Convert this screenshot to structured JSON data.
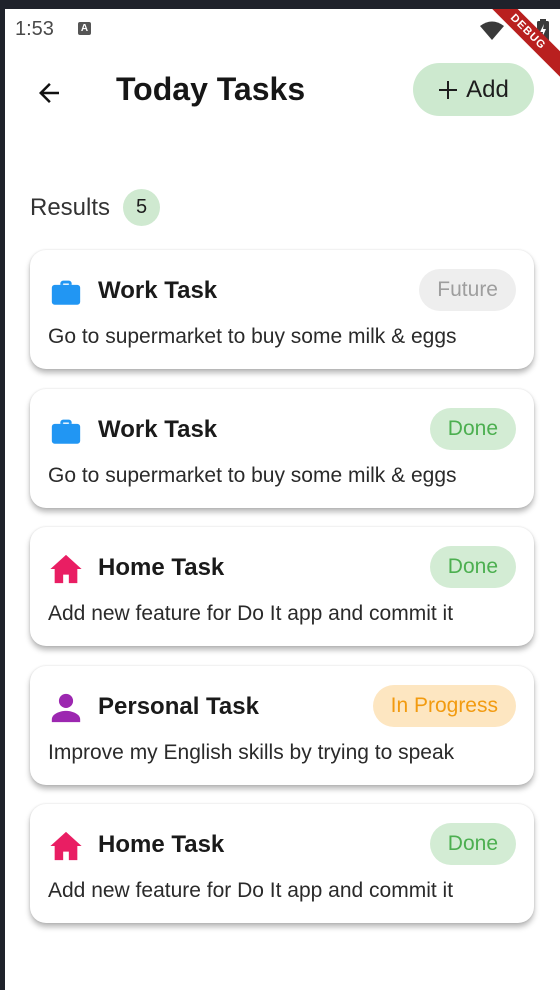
{
  "status_bar": {
    "time": "1:53",
    "notification_icon_letter": "A",
    "debug_label": "DEBUG"
  },
  "header": {
    "title": "Today Tasks",
    "add_label": "Add"
  },
  "results": {
    "label": "Results",
    "count": "5"
  },
  "colors": {
    "accent_green": "#cde9cf",
    "work_icon": "#2196f3",
    "home_icon": "#e91e63",
    "personal_icon": "#9c27b0",
    "done_text": "#4caf50",
    "progress_text": "#f29b10",
    "future_text": "#9e9e9e"
  },
  "tasks": [
    {
      "category": "work",
      "icon": "briefcase-icon",
      "title": "Work Task",
      "description": "Go to supermarket to buy some milk & eggs",
      "status": "Future"
    },
    {
      "category": "work",
      "icon": "briefcase-icon",
      "title": "Work Task",
      "description": "Go to supermarket to buy some milk & eggs",
      "status": "Done"
    },
    {
      "category": "home",
      "icon": "home-icon",
      "title": "Home Task",
      "description": "Add new feature for Do It app and commit it",
      "status": "Done"
    },
    {
      "category": "personal",
      "icon": "person-icon",
      "title": "Personal Task",
      "description": "Improve my English skills by trying to speak",
      "status": "In Progress"
    },
    {
      "category": "home",
      "icon": "home-icon",
      "title": "Home Task",
      "description": "Add new feature for Do It app and commit it",
      "status": "Done"
    }
  ]
}
